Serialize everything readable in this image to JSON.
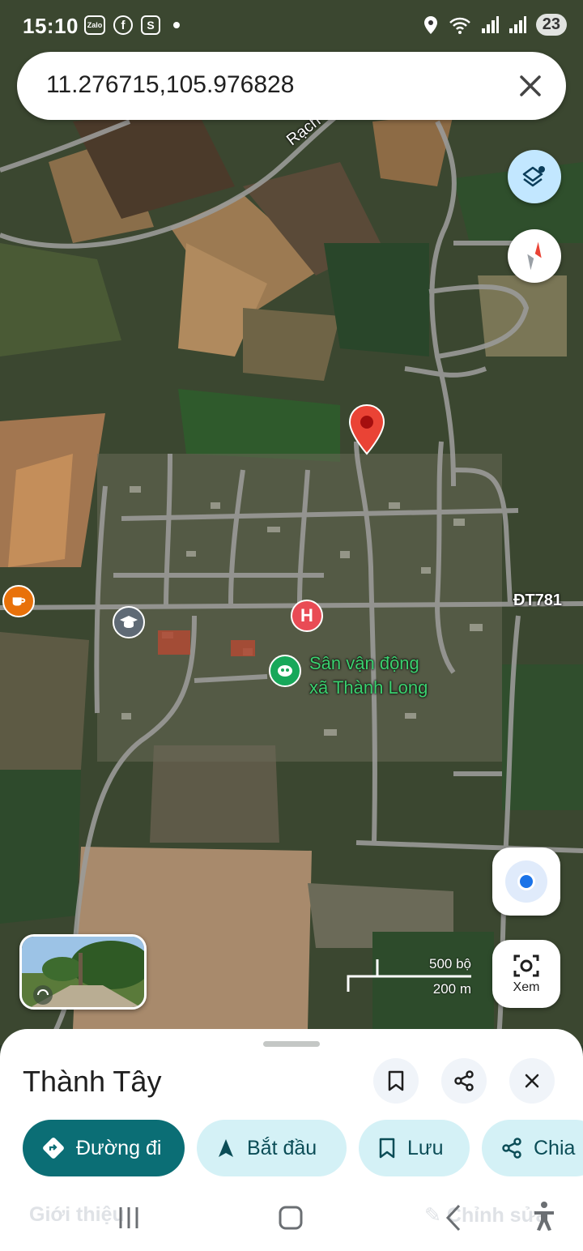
{
  "status_bar": {
    "time": "15:10",
    "notification_icons": [
      "zalo-icon",
      "facebook-icon",
      "shopee-icon"
    ],
    "zalo_label": "Zalo",
    "battery": "23"
  },
  "search": {
    "query": "11.276715,105.976828",
    "clear_icon": "close-icon"
  },
  "map": {
    "road_label_top": "Rạch",
    "road_label_right": "ĐT781",
    "poi_stadium_line1": "Sân vận động",
    "poi_stadium_line2": "xã Thành Long",
    "scale_imperial": "500 bộ",
    "scale_metric": "200 m",
    "lens_label": "Xem"
  },
  "place": {
    "title": "Thành Tây"
  },
  "actions": {
    "directions": "Đường đi",
    "start": "Bắt đầu",
    "save": "Lưu",
    "share": "Chia"
  },
  "sheet_behind": {
    "about_tab": "Giới thiệu",
    "edit_label": "Chỉnh sửa"
  },
  "colors": {
    "primary_chip": "#0b6e75",
    "secondary_chip": "#d4f1f6",
    "pin_red": "#ea4335",
    "poi_green": "#3bd16f"
  }
}
